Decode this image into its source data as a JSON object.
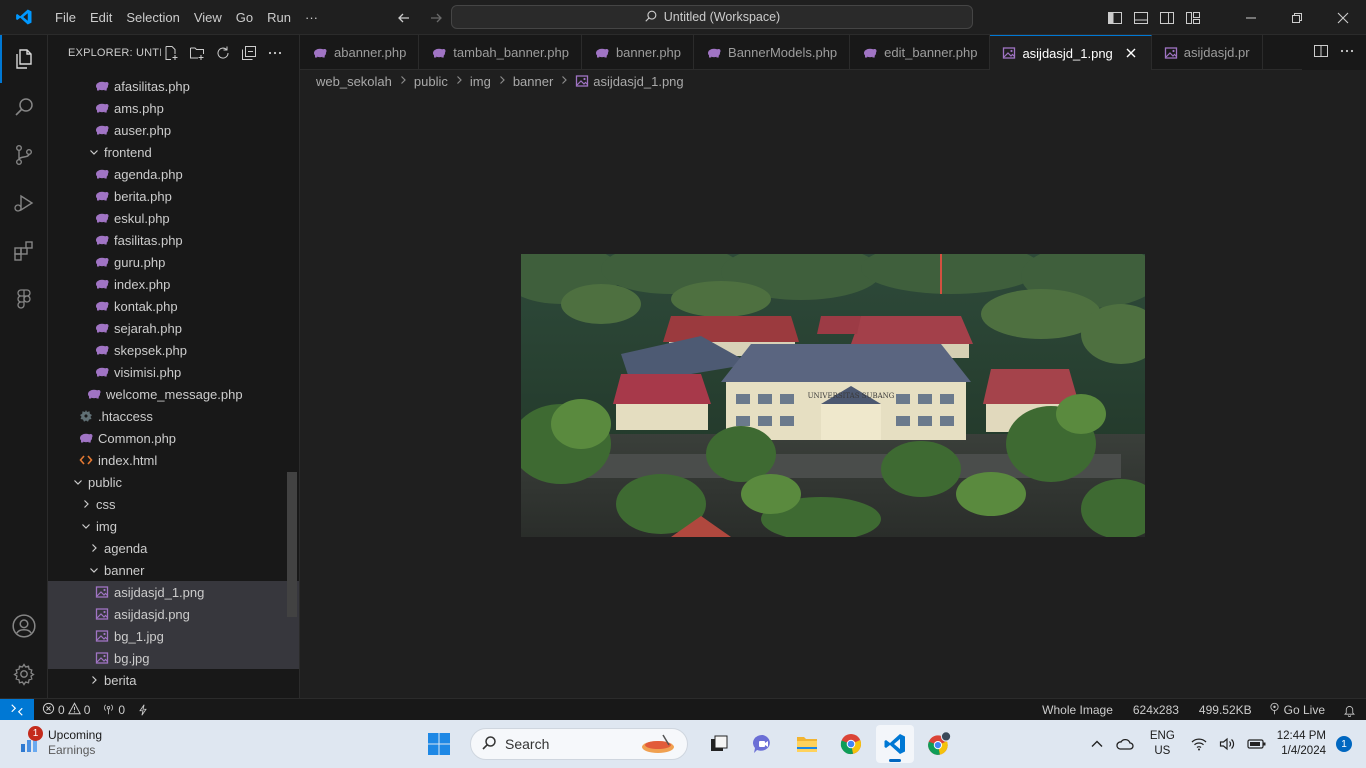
{
  "titlebar": {
    "menu": [
      "File",
      "Edit",
      "Selection",
      "View",
      "Go",
      "Run",
      "···"
    ],
    "command_center": "Untitled (Workspace)"
  },
  "sidebar": {
    "header": "EXPLORER: UNTI...",
    "tree": [
      {
        "label": "afasilitas.php",
        "indent": 5,
        "type": "php"
      },
      {
        "label": "ams.php",
        "indent": 5,
        "type": "php"
      },
      {
        "label": "auser.php",
        "indent": 5,
        "type": "php"
      },
      {
        "label": "frontend",
        "indent": 4,
        "type": "folder-open"
      },
      {
        "label": "agenda.php",
        "indent": 5,
        "type": "php"
      },
      {
        "label": "berita.php",
        "indent": 5,
        "type": "php"
      },
      {
        "label": "eskul.php",
        "indent": 5,
        "type": "php"
      },
      {
        "label": "fasilitas.php",
        "indent": 5,
        "type": "php"
      },
      {
        "label": "guru.php",
        "indent": 5,
        "type": "php"
      },
      {
        "label": "index.php",
        "indent": 5,
        "type": "php"
      },
      {
        "label": "kontak.php",
        "indent": 5,
        "type": "php"
      },
      {
        "label": "sejarah.php",
        "indent": 5,
        "type": "php"
      },
      {
        "label": "skepsek.php",
        "indent": 5,
        "type": "php"
      },
      {
        "label": "visimisi.php",
        "indent": 5,
        "type": "php"
      },
      {
        "label": "welcome_message.php",
        "indent": 4,
        "type": "php"
      },
      {
        "label": ".htaccess",
        "indent": 3,
        "type": "gear"
      },
      {
        "label": "Common.php",
        "indent": 3,
        "type": "php"
      },
      {
        "label": "index.html",
        "indent": 3,
        "type": "html"
      },
      {
        "label": "public",
        "indent": 2,
        "type": "folder-open"
      },
      {
        "label": "css",
        "indent": 3,
        "type": "folder-closed"
      },
      {
        "label": "img",
        "indent": 3,
        "type": "folder-open"
      },
      {
        "label": "agenda",
        "indent": 4,
        "type": "folder-closed"
      },
      {
        "label": "banner",
        "indent": 4,
        "type": "folder-open"
      },
      {
        "label": "asijdasjd_1.png",
        "indent": 5,
        "type": "image",
        "selected": true
      },
      {
        "label": "asijdasjd.png",
        "indent": 5,
        "type": "image",
        "selected": true
      },
      {
        "label": "bg_1.jpg",
        "indent": 5,
        "type": "image",
        "selected": true
      },
      {
        "label": "bg.jpg",
        "indent": 5,
        "type": "image",
        "selected": true
      },
      {
        "label": "berita",
        "indent": 4,
        "type": "folder-closed"
      }
    ]
  },
  "tabs": [
    {
      "label": "abanner.php",
      "type": "php"
    },
    {
      "label": "tambah_banner.php",
      "type": "php"
    },
    {
      "label": "banner.php",
      "type": "php"
    },
    {
      "label": "BannerModels.php",
      "type": "php"
    },
    {
      "label": "edit_banner.php",
      "type": "php"
    },
    {
      "label": "asijdasjd_1.png",
      "type": "image",
      "active": true
    },
    {
      "label": "asijdasjd.pr",
      "type": "image"
    }
  ],
  "breadcrumb": [
    "web_sekolah",
    "public",
    "img",
    "banner",
    "asijdasjd_1.png"
  ],
  "image_viewer": {
    "sign_text": "UNIVERSITAS SUBANG"
  },
  "statusbar": {
    "errors": "0",
    "warnings": "0",
    "ports": "0",
    "zoom": "Whole Image",
    "dimensions": "624x283",
    "filesize": "499.52KB",
    "golive": "Go Live"
  },
  "taskbar": {
    "weather_title": "Upcoming",
    "weather_sub": "Earnings",
    "weather_badge": "1",
    "search_placeholder": "Search",
    "lang_top": "ENG",
    "lang_bottom": "US",
    "time": "12:44 PM",
    "date": "1/4/2024",
    "notifications": "1"
  },
  "colors": {
    "accent": "#0078d4",
    "php_icon": "#a074c4",
    "html_icon": "#e37933",
    "folder_chevron": "#cccccc"
  }
}
